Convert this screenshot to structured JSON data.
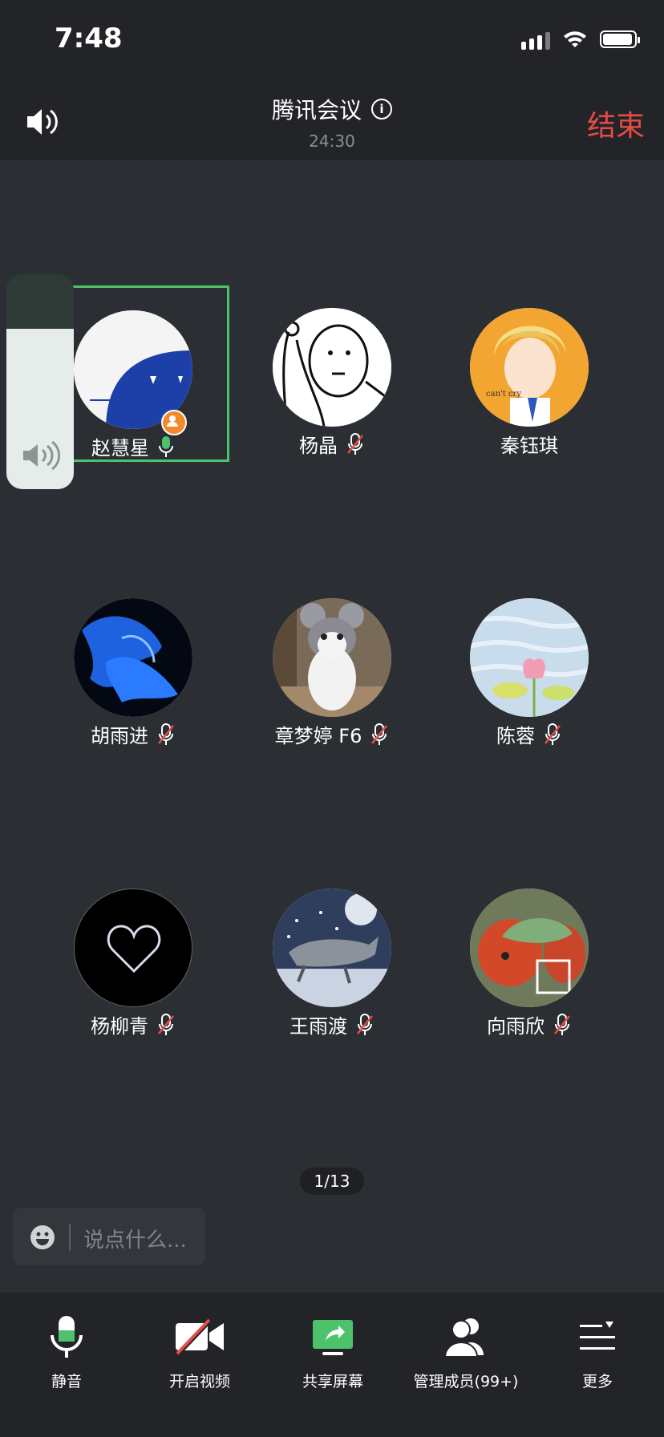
{
  "status_bar": {
    "time": "7:48"
  },
  "header": {
    "title": "腾讯会议",
    "duration": "24:30",
    "end_label": "结束"
  },
  "participants": [
    {
      "name": "赵慧星",
      "mic": "on",
      "host": true,
      "active": true
    },
    {
      "name": "杨晶",
      "mic": "muted"
    },
    {
      "name": "秦钰琪",
      "mic": "none"
    },
    {
      "name": "胡雨进",
      "mic": "muted"
    },
    {
      "name": "章梦婷 F6",
      "mic": "muted"
    },
    {
      "name": "陈蓉",
      "mic": "muted"
    },
    {
      "name": "杨柳青",
      "mic": "muted"
    },
    {
      "name": "王雨渡",
      "mic": "muted"
    },
    {
      "name": "向雨欣",
      "mic": "muted"
    }
  ],
  "pagination": {
    "label": "1/13"
  },
  "chat": {
    "placeholder": "说点什么..."
  },
  "toolbar": {
    "mute_label": "静音",
    "video_label": "开启视频",
    "share_label": "共享屏幕",
    "members_label": "管理成员(99+)",
    "more_label": "更多"
  },
  "colors": {
    "accent_green": "#4ec26b",
    "end_red": "#e64c45",
    "host_orange": "#f08a2c"
  }
}
